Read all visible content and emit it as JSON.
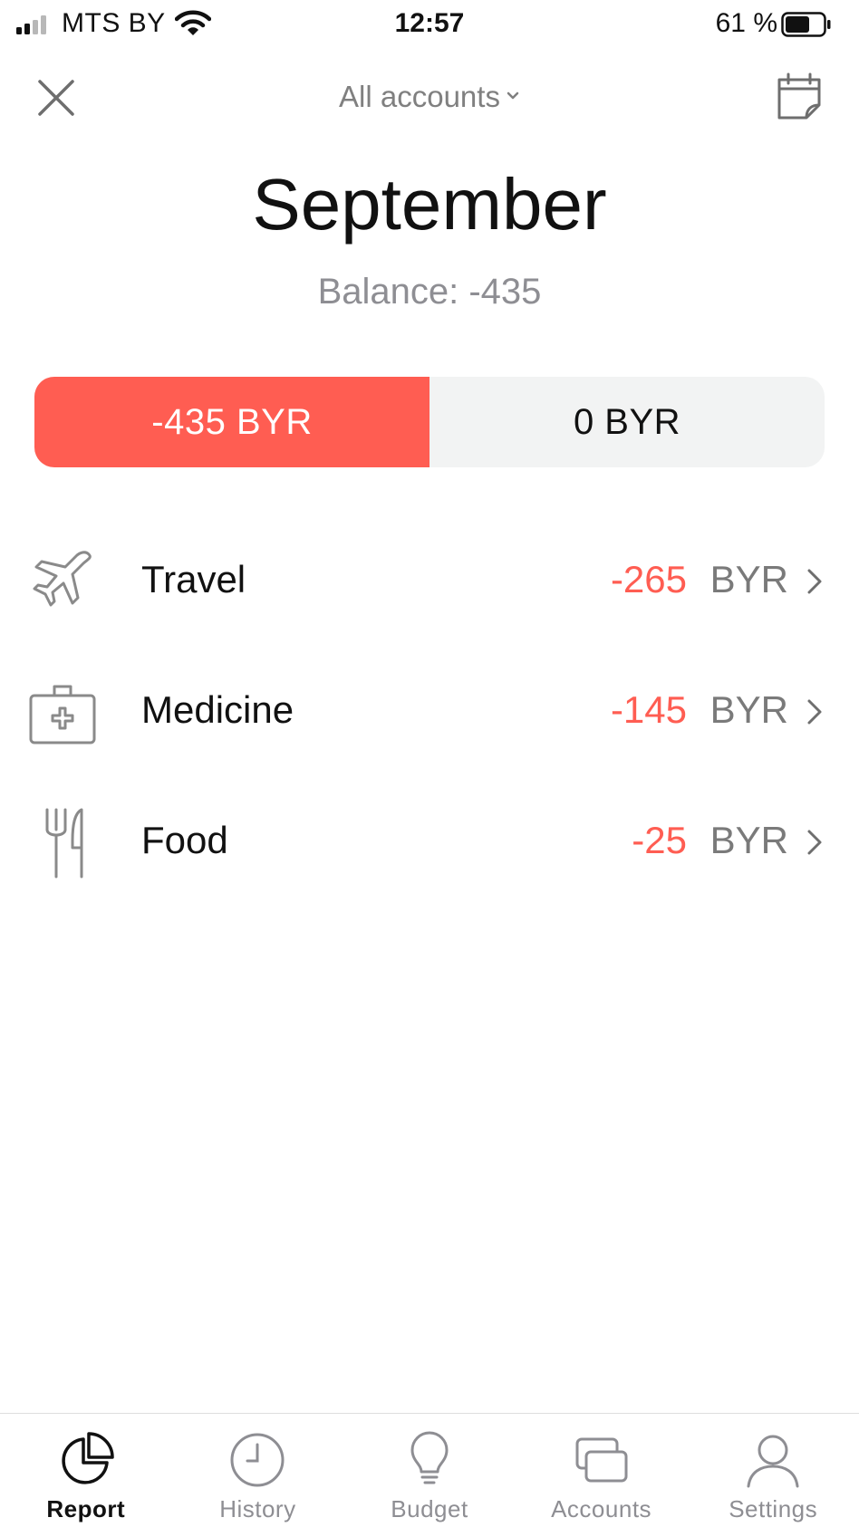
{
  "status_bar": {
    "carrier": "MTS BY",
    "time": "12:57",
    "battery": "61 %"
  },
  "header": {
    "account_selector": "All accounts",
    "month": "September",
    "balance": "Balance: -435"
  },
  "segment": {
    "expenses": "-435  BYR",
    "income": "0  BYR",
    "active": "expenses"
  },
  "categories": [
    {
      "icon": "airplane-icon",
      "name": "Travel",
      "amount": "-265",
      "currency": "BYR"
    },
    {
      "icon": "medical-kit-icon",
      "name": "Medicine",
      "amount": "-145",
      "currency": "BYR"
    },
    {
      "icon": "fork-knife-icon",
      "name": "Food",
      "amount": "-25",
      "currency": "BYR"
    }
  ],
  "tabs": [
    {
      "icon": "pie-chart-icon",
      "label": "Report",
      "active": true
    },
    {
      "icon": "clock-icon",
      "label": "History",
      "active": false
    },
    {
      "icon": "lightbulb-icon",
      "label": "Budget",
      "active": false
    },
    {
      "icon": "cards-icon",
      "label": "Accounts",
      "active": false
    },
    {
      "icon": "person-icon",
      "label": "Settings",
      "active": false
    }
  ],
  "colors": {
    "accent_expense": "#ff5d52",
    "segment_inactive_bg": "#f2f3f3",
    "muted_text": "#8e8e93",
    "icon_gray": "#8a8a8a"
  }
}
